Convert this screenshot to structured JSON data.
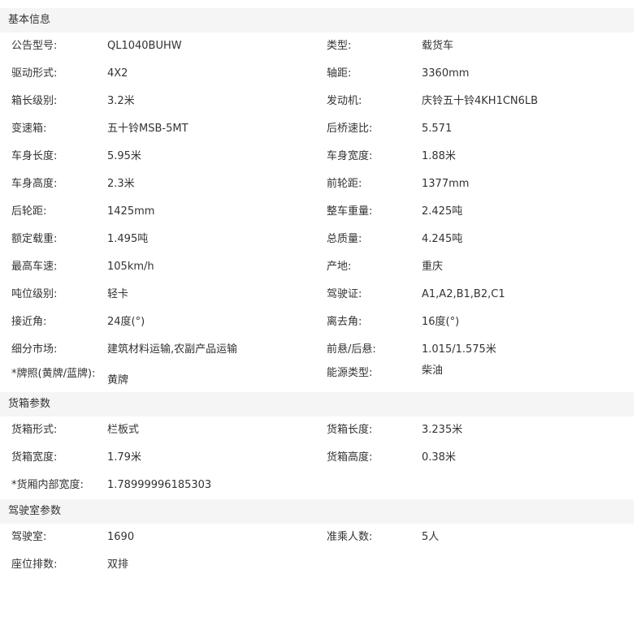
{
  "sections": [
    {
      "title": "基本信息",
      "rows": [
        [
          "公告型号:",
          "QL1040BUHW",
          "类型:",
          "载货车"
        ],
        [
          "驱动形式:",
          "4X2",
          "轴距:",
          "3360mm"
        ],
        [
          "箱长级别:",
          "3.2米",
          "发动机:",
          "庆铃五十铃4KH1CN6LB"
        ],
        [
          "变速箱:",
          "五十铃MSB-5MT",
          "后桥速比:",
          "5.571"
        ],
        [
          "车身长度:",
          "5.95米",
          "车身宽度:",
          "1.88米"
        ],
        [
          "车身高度:",
          "2.3米",
          "前轮距:",
          "1377mm"
        ],
        [
          "后轮距:",
          "1425mm",
          "整车重量:",
          "2.425吨"
        ],
        [
          "额定载重:",
          "1.495吨",
          "总质量:",
          "4.245吨"
        ],
        [
          "最高车速:",
          "105km/h",
          "产地:",
          "重庆"
        ],
        [
          "吨位级别:",
          "轻卡",
          "驾驶证:",
          "A1,A2,B1,B2,C1"
        ],
        [
          "接近角:",
          "24度(°)",
          "离去角:",
          "16度(°)"
        ],
        [
          "细分市场:",
          "建筑材料运输,农副产品运输",
          "前悬/后悬:",
          "1.015/1.575米"
        ],
        [
          "*牌照(黄牌/蓝牌):",
          "黄牌",
          "能源类型:",
          "柴油"
        ]
      ]
    },
    {
      "title": "货箱参数",
      "rows": [
        [
          "货箱形式:",
          "栏板式",
          "货箱长度:",
          "3.235米"
        ],
        [
          "货箱宽度:",
          "1.79米",
          "货箱高度:",
          "0.38米"
        ],
        [
          "*货厢内部宽度:",
          "1.78999996185303",
          "",
          ""
        ]
      ]
    },
    {
      "title": "驾驶室参数",
      "rows": [
        [
          "驾驶室:",
          "1690",
          "准乘人数:",
          "5人"
        ],
        [
          "座位排数:",
          "双排",
          "",
          ""
        ]
      ]
    }
  ]
}
